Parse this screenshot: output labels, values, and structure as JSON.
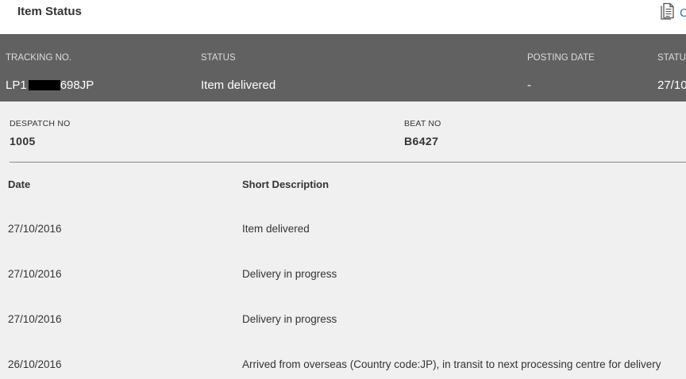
{
  "header": {
    "title": "Item Status",
    "doc_action_label": "C"
  },
  "summary": {
    "headers": {
      "tracking": "TRACKING NO.",
      "status": "STATUS",
      "posting_date": "POSTING DATE",
      "status_date": "STATU"
    },
    "values": {
      "tracking_prefix": "LP1",
      "tracking_suffix": "698JP",
      "status": "Item delivered",
      "posting_date": "-",
      "status_date": "27/10"
    }
  },
  "details": {
    "despatch_label": "DESPATCH NO",
    "despatch_value": "1005",
    "beat_label": "BEAT NO",
    "beat_value": "B6427"
  },
  "events": {
    "columns": [
      "Date",
      "Short Description"
    ],
    "rows": [
      {
        "date": "27/10/2016",
        "description": "Item delivered"
      },
      {
        "date": "27/10/2016",
        "description": "Delivery in progress"
      },
      {
        "date": "27/10/2016",
        "description": "Delivery in progress"
      },
      {
        "date": "26/10/2016",
        "description": "Arrived from overseas (Country code:JP), in transit to next processing centre for delivery"
      }
    ]
  },
  "icons": {
    "doc_action": "document-icon"
  }
}
